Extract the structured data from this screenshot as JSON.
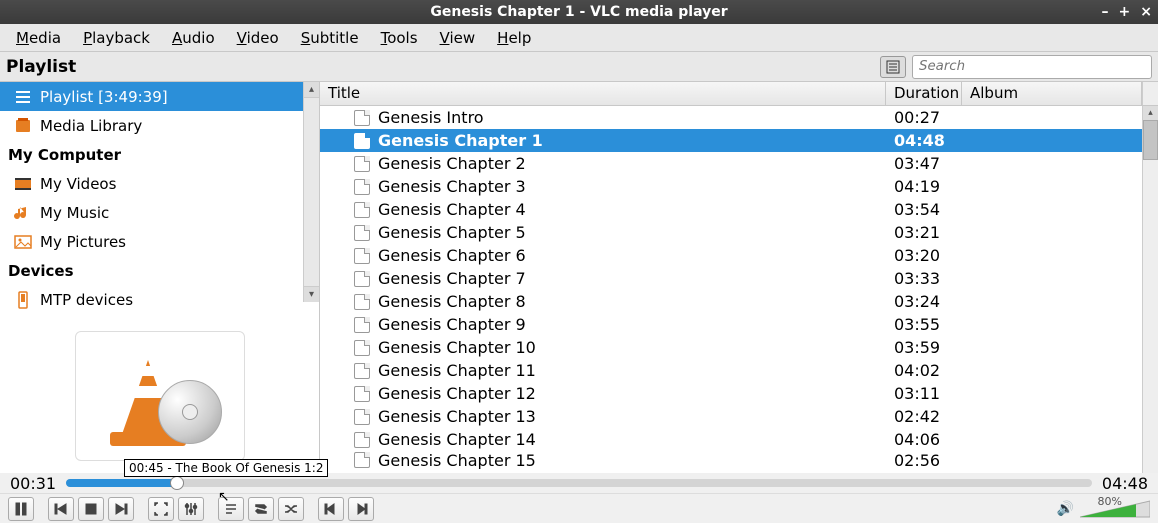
{
  "window": {
    "title": "Genesis Chapter 1 - VLC media player",
    "minimize": "–",
    "maximize": "+",
    "close": "×"
  },
  "menubar": [
    "Media",
    "Playback",
    "Audio",
    "Video",
    "Subtitle",
    "Tools",
    "View",
    "Help"
  ],
  "header": {
    "title": "Playlist",
    "search_placeholder": "Search"
  },
  "sidebar": {
    "items": [
      {
        "label": "Playlist [3:49:39]",
        "icon": "playlist",
        "indented": true,
        "selected": true
      },
      {
        "label": "Media Library",
        "icon": "library",
        "indented": true
      }
    ],
    "section1": "My Computer",
    "section1_items": [
      {
        "label": "My Videos",
        "icon": "video"
      },
      {
        "label": "My Music",
        "icon": "music"
      },
      {
        "label": "My Pictures",
        "icon": "pictures"
      }
    ],
    "section2": "Devices",
    "section2_items": [
      {
        "label": "MTP devices",
        "icon": "mtp"
      }
    ]
  },
  "tooltip": "00:45 -  The Book Of Genesis 1:2",
  "columns": {
    "title": "Title",
    "duration": "Duration",
    "album": "Album"
  },
  "tracks": [
    {
      "title": "Genesis Intro",
      "duration": "00:27",
      "selected": false
    },
    {
      "title": "Genesis Chapter 1",
      "duration": "04:48",
      "selected": true
    },
    {
      "title": "Genesis Chapter 2",
      "duration": "03:47"
    },
    {
      "title": "Genesis Chapter 3",
      "duration": "04:19"
    },
    {
      "title": "Genesis Chapter 4",
      "duration": "03:54"
    },
    {
      "title": "Genesis Chapter 5",
      "duration": "03:21"
    },
    {
      "title": "Genesis Chapter 6",
      "duration": "03:20"
    },
    {
      "title": "Genesis Chapter 7",
      "duration": "03:33"
    },
    {
      "title": "Genesis Chapter 8",
      "duration": "03:24"
    },
    {
      "title": "Genesis Chapter 9",
      "duration": "03:55"
    },
    {
      "title": "Genesis Chapter 10",
      "duration": "03:59"
    },
    {
      "title": "Genesis Chapter 11",
      "duration": "04:02"
    },
    {
      "title": "Genesis Chapter 12",
      "duration": "03:11"
    },
    {
      "title": "Genesis Chapter 13",
      "duration": "02:42"
    },
    {
      "title": "Genesis Chapter 14",
      "duration": "04:06"
    },
    {
      "title": "Genesis Chapter 15",
      "duration": "02:56",
      "partial": true
    }
  ],
  "time": {
    "elapsed": "00:31",
    "total": "04:48"
  },
  "volume": {
    "percent": "80%"
  }
}
